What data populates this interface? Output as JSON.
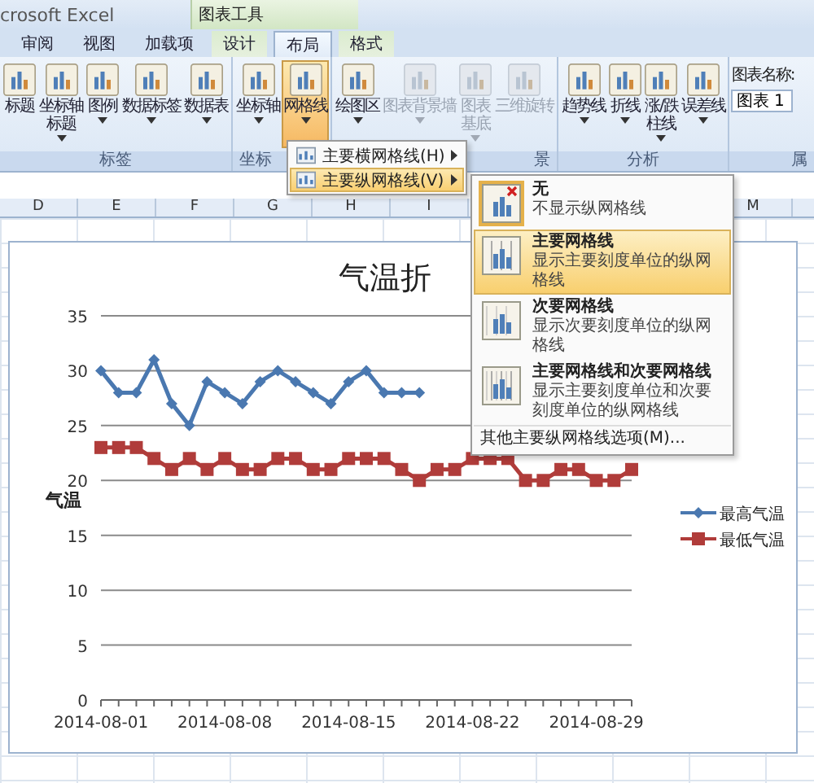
{
  "title_bar": {
    "app_title": "crosoft Excel",
    "context_label": "图表工具"
  },
  "tabs": [
    {
      "label": "审阅",
      "selected": false,
      "contextual": false
    },
    {
      "label": "视图",
      "selected": false,
      "contextual": false
    },
    {
      "label": "加载项",
      "selected": false,
      "contextual": false
    },
    {
      "label": "设计",
      "selected": false,
      "contextual": true
    },
    {
      "label": "布局",
      "selected": true,
      "contextual": true
    },
    {
      "label": "格式",
      "selected": false,
      "contextual": true
    }
  ],
  "ribbon": {
    "groups": [
      {
        "label": "标签",
        "truncated_end": false,
        "truncated_start": false,
        "buttons": [
          {
            "label": [
              "标题"
            ],
            "dropdown": false,
            "disabled": false,
            "pressed": false
          },
          {
            "label": [
              "坐标轴",
              "标题"
            ],
            "dropdown": true,
            "disabled": false,
            "pressed": false
          },
          {
            "label": [
              "图例"
            ],
            "dropdown": true,
            "disabled": false,
            "pressed": false
          },
          {
            "label": [
              "数据标签"
            ],
            "dropdown": true,
            "disabled": false,
            "pressed": false
          },
          {
            "label": [
              "数据表"
            ],
            "dropdown": true,
            "disabled": false,
            "pressed": false
          }
        ]
      },
      {
        "label": "坐标",
        "truncated_end": true,
        "truncated_start": false,
        "buttons": [
          {
            "label": [
              "坐标轴"
            ],
            "dropdown": true,
            "disabled": false,
            "pressed": false
          },
          {
            "label": [
              "网格线"
            ],
            "dropdown": true,
            "disabled": false,
            "pressed": true
          }
        ]
      },
      {
        "label": "景",
        "truncated_end": false,
        "truncated_start": true,
        "buttons": [
          {
            "label": [
              "绘图区"
            ],
            "dropdown": true,
            "disabled": false,
            "pressed": false
          },
          {
            "label": [
              "图表背景墙"
            ],
            "dropdown": true,
            "disabled": true,
            "pressed": false
          },
          {
            "label": [
              "图表",
              "基底"
            ],
            "dropdown": true,
            "disabled": true,
            "pressed": false
          },
          {
            "label": [
              "三维旋转"
            ],
            "dropdown": false,
            "disabled": true,
            "pressed": false
          }
        ]
      },
      {
        "label": "分析",
        "truncated_end": false,
        "truncated_start": false,
        "buttons": [
          {
            "label": [
              "趋势线"
            ],
            "dropdown": true,
            "disabled": false,
            "pressed": false
          },
          {
            "label": [
              "折线"
            ],
            "dropdown": true,
            "disabled": false,
            "pressed": false
          },
          {
            "label": [
              "涨/跌",
              "柱线"
            ],
            "dropdown": true,
            "disabled": false,
            "pressed": false
          },
          {
            "label": [
              "误差线"
            ],
            "dropdown": true,
            "disabled": false,
            "pressed": false
          }
        ]
      }
    ],
    "chart_name": {
      "label": "图表名称:",
      "value": "图表 1",
      "group_label": "属"
    }
  },
  "menu": {
    "items": [
      {
        "label": "主要横网格线(H)",
        "highlighted": false
      },
      {
        "label": "主要纵网格线(V)",
        "highlighted": true
      }
    ]
  },
  "submenu": {
    "options": [
      {
        "title": "无",
        "description": "不显示纵网格线",
        "kind": "none",
        "checked": true,
        "highlighted": false
      },
      {
        "title": "主要网格线",
        "description": "显示主要刻度单位的纵网格线",
        "kind": "major",
        "checked": false,
        "highlighted": true
      },
      {
        "title": "次要网格线",
        "description": "显示次要刻度单位的纵网格线",
        "kind": "minor",
        "checked": false,
        "highlighted": false
      },
      {
        "title": "主要网格线和次要网格线",
        "description": "显示主要刻度单位和次要刻度单位的纵网格线",
        "kind": "both",
        "checked": false,
        "highlighted": false
      }
    ],
    "more": "其他主要纵网格线选项(M)..."
  },
  "column_headers": {
    "left": [
      "D",
      "E",
      "F",
      "G",
      "H",
      "I"
    ],
    "right": [
      "M"
    ]
  },
  "chart": {
    "chart_data": {
      "type": "line",
      "title": "气温折",
      "ylabel": "气温",
      "grid": true,
      "legend": "right",
      "categories": [
        "2014-08-01",
        null,
        null,
        null,
        null,
        null,
        null,
        "2014-08-08",
        null,
        null,
        null,
        null,
        null,
        null,
        "2014-08-15",
        null,
        null,
        null,
        null,
        null,
        null,
        "2014-08-22",
        null,
        null,
        null,
        null,
        null,
        null,
        "2014-08-29",
        null,
        null
      ],
      "series": [
        {
          "name": "最高气温",
          "color": "#4a78b0",
          "marker": "diamond",
          "values": [
            30,
            28,
            28,
            31,
            27,
            25,
            29,
            28,
            27,
            29,
            30,
            29,
            28,
            27,
            29,
            30,
            28,
            28,
            28,
            null,
            null,
            null,
            null,
            null,
            null,
            null,
            null,
            null,
            null,
            null,
            null
          ]
        },
        {
          "name": "最低气温",
          "color": "#b03c3a",
          "marker": "square",
          "values": [
            23,
            23,
            23,
            22,
            21,
            22,
            21,
            22,
            21,
            21,
            22,
            22,
            21,
            21,
            22,
            22,
            22,
            21,
            20,
            21,
            21,
            22,
            22,
            22,
            20,
            20,
            21,
            21,
            20,
            20,
            21
          ]
        }
      ],
      "ylim": [
        0,
        35
      ],
      "yticks": [
        0,
        5,
        10,
        15,
        20,
        25,
        30,
        35
      ]
    }
  }
}
